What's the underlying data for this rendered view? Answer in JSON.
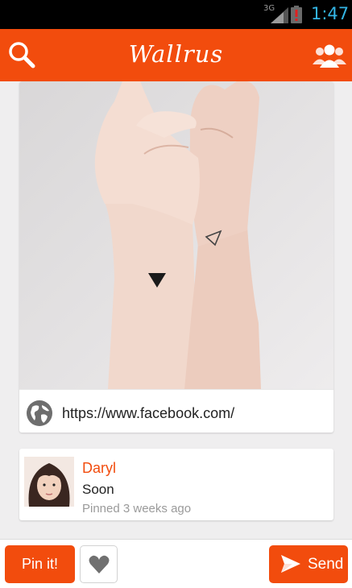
{
  "status_bar": {
    "network": "3G",
    "time": "1:47"
  },
  "app_bar": {
    "title": "Wallrus",
    "search_icon": "search-icon",
    "people_icon": "people-icon"
  },
  "pin": {
    "image": "wrist-triangle-tattoos-photo",
    "link": {
      "icon": "globe-icon",
      "url": "https://www.facebook.com/"
    }
  },
  "comment": {
    "user": "Daryl",
    "text": "Soon",
    "time": "Pinned 3 weeks ago"
  },
  "bottom_bar": {
    "pin_label": "Pin it!",
    "like_icon": "heart-icon",
    "send_label": "Send",
    "send_icon": "send-icon"
  },
  "colors": {
    "accent": "#f24c0d",
    "status_time": "#33b5e5"
  }
}
